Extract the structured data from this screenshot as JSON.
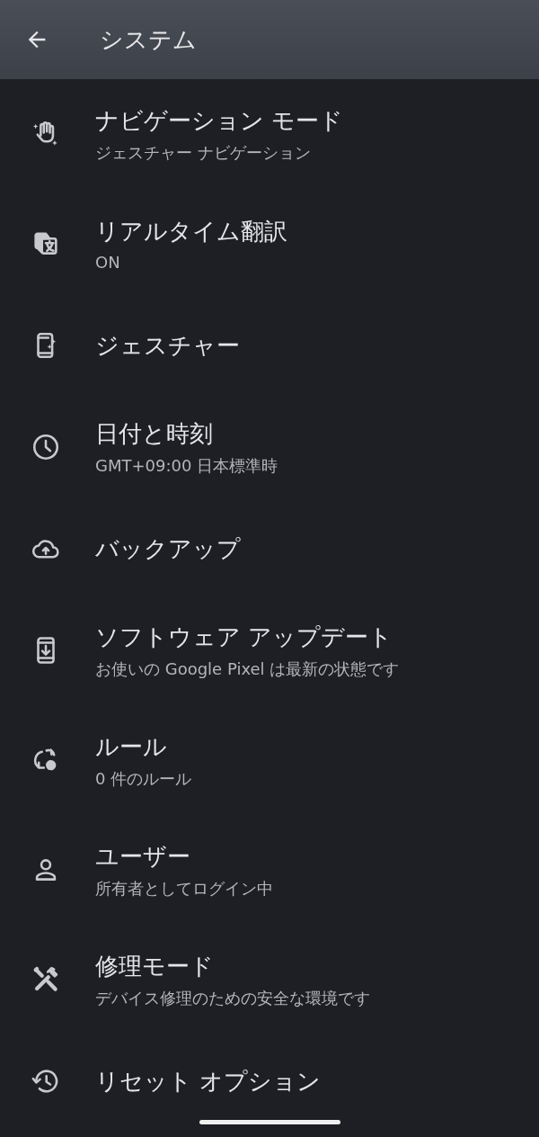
{
  "app_bar": {
    "title": "システム"
  },
  "items": [
    {
      "title": "ナビゲーション モード",
      "subtitle": "ジェスチャー ナビゲーション"
    },
    {
      "title": "リアルタイム翻訳",
      "subtitle": "ON"
    },
    {
      "title": "ジェスチャー"
    },
    {
      "title": "日付と時刻",
      "subtitle": "GMT+09:00 日本標準時"
    },
    {
      "title": "バックアップ"
    },
    {
      "title": "ソフトウェア アップデート",
      "subtitle": "お使いの Google Pixel は最新の状態です"
    },
    {
      "title": "ルール",
      "subtitle": "0 件のルール"
    },
    {
      "title": "ユーザー",
      "subtitle": "所有者としてログイン中"
    },
    {
      "title": "修理モード",
      "subtitle": "デバイス修理のための安全な環境です"
    },
    {
      "title": "リセット オプション"
    }
  ]
}
